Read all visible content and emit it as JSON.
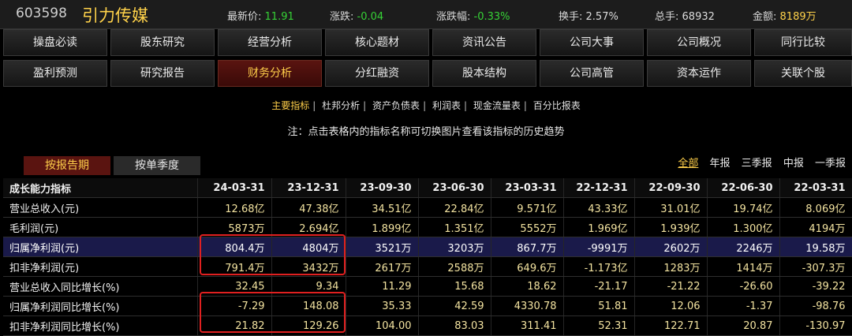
{
  "header": {
    "code": "603598",
    "name": "引力传媒",
    "fields": [
      {
        "label": "最新价:",
        "value": "11.91",
        "tone": "v"
      },
      {
        "label": "涨跌:",
        "value": "-0.04",
        "tone": "v"
      },
      {
        "label": "涨跌幅:",
        "value": "-0.33%",
        "tone": "v"
      },
      {
        "label": "换手:",
        "value": "2.57%",
        "tone": "w"
      },
      {
        "label": "总手:",
        "value": "68932",
        "tone": "w"
      },
      {
        "label": "金额:",
        "value": "8189万",
        "tone": "y"
      }
    ]
  },
  "nav": {
    "row1": [
      "操盘必读",
      "股东研究",
      "经营分析",
      "核心题材",
      "资讯公告",
      "公司大事",
      "公司概况",
      "同行比较"
    ],
    "row2": [
      "盈利预测",
      "研究报告",
      "财务分析",
      "分红融资",
      "股本结构",
      "公司高管",
      "资本运作",
      "关联个股"
    ],
    "active": "财务分析"
  },
  "sublinks": [
    "主要指标",
    "杜邦分析",
    "资产负债表",
    "利润表",
    "现金流量表",
    "百分比报表"
  ],
  "sublinks_active": "主要指标",
  "note": "注：点击表格内的指标名称可切换图片查看该指标的历史趋势",
  "toggle": {
    "report": "按报告期",
    "quarter": "按单季度"
  },
  "periods": {
    "items": [
      "全部",
      "年报",
      "三季报",
      "中报",
      "一季报"
    ],
    "selected": "全部"
  },
  "table": {
    "header": [
      "成长能力指标",
      "24-03-31",
      "23-12-31",
      "23-09-30",
      "23-06-30",
      "23-03-31",
      "22-12-31",
      "22-09-30",
      "22-06-30",
      "22-03-31"
    ],
    "rows": [
      {
        "label": "营业总收入(元)",
        "values": [
          "12.68亿",
          "47.38亿",
          "34.51亿",
          "22.84亿",
          "9.571亿",
          "43.33亿",
          "31.01亿",
          "19.74亿",
          "8.069亿"
        ]
      },
      {
        "label": "毛利润(元)",
        "values": [
          "5873万",
          "2.694亿",
          "1.899亿",
          "1.351亿",
          "5552万",
          "1.969亿",
          "1.939亿",
          "1.300亿",
          "4194万"
        ]
      },
      {
        "label": "归属净利润(元)",
        "values": [
          "804.4万",
          "4804万",
          "3521万",
          "3203万",
          "867.7万",
          "-9991万",
          "2602万",
          "2246万",
          "19.58万"
        ],
        "highlight": true
      },
      {
        "label": "扣非净利润(元)",
        "values": [
          "791.4万",
          "3432万",
          "2617万",
          "2588万",
          "649.6万",
          "-1.173亿",
          "1283万",
          "1414万",
          "-307.3万"
        ]
      },
      {
        "label": "营业总收入同比增长(%)",
        "values": [
          "32.45",
          "9.34",
          "11.29",
          "15.68",
          "18.62",
          "-21.17",
          "-21.22",
          "-26.60",
          "-39.22"
        ]
      },
      {
        "label": "归属净利润同比增长(%)",
        "values": [
          "-7.29",
          "148.08",
          "35.33",
          "42.59",
          "4330.78",
          "51.81",
          "12.06",
          "-1.37",
          "-98.76"
        ]
      },
      {
        "label": "扣非净利润同比增长(%)",
        "values": [
          "21.82",
          "129.26",
          "104.00",
          "83.03",
          "311.41",
          "52.31",
          "122.71",
          "20.87",
          "-130.97"
        ]
      }
    ]
  }
}
